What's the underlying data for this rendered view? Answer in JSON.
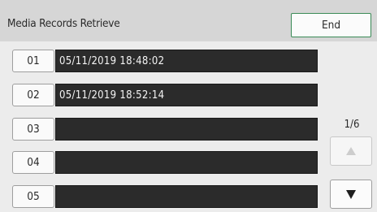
{
  "header": {
    "title": "Media Records Retrieve",
    "end_label": "End"
  },
  "records": [
    {
      "number": "01",
      "value": "05/11/2019 18:48:02"
    },
    {
      "number": "02",
      "value": "05/11/2019 18:52:14"
    },
    {
      "number": "03",
      "value": ""
    },
    {
      "number": "04",
      "value": ""
    },
    {
      "number": "05",
      "value": ""
    }
  ],
  "pagination": {
    "indicator": "1/6",
    "up_icon": "triangle-up-icon",
    "down_icon": "triangle-down-icon",
    "up_enabled": false,
    "down_enabled": true
  }
}
